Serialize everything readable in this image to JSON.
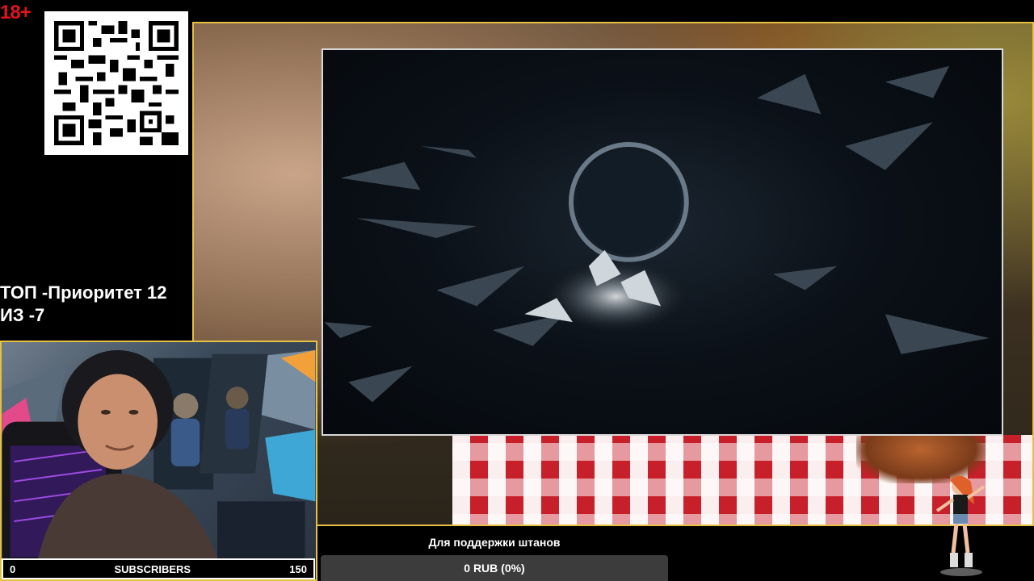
{
  "age_badge": "18+",
  "ticker": {
    "line1": "ТОП -Приоритет 12",
    "line2": "ИЗ -7"
  },
  "subscribers": {
    "current": "0",
    "label": "SUBSCRIBERS",
    "goal": "150",
    "progress_fraction": 0
  },
  "donation": {
    "title": "Для поддержки штанов",
    "amount_text": "0 RUB (0%)",
    "progress_percent": 0
  },
  "colors": {
    "frame_accent": "#e6c040",
    "age_badge": "#e1141e"
  },
  "icons": [
    "qr-code-icon",
    "dancer-sprite"
  ]
}
